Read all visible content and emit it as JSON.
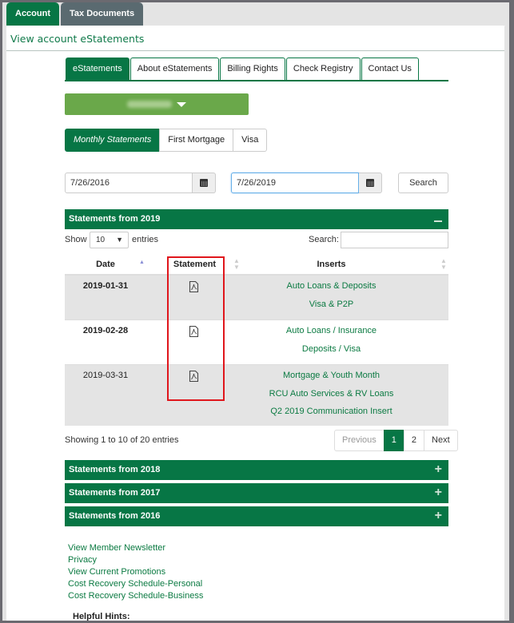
{
  "top_tabs": [
    {
      "label": "Account",
      "active": true
    },
    {
      "label": "Tax Documents",
      "active": false
    }
  ],
  "page_title": "View account eStatements",
  "nav_tabs": [
    {
      "label": "eStatements",
      "active": true
    },
    {
      "label": "About eStatements",
      "active": false
    },
    {
      "label": "Billing Rights",
      "active": false
    },
    {
      "label": "Check Registry",
      "active": false
    },
    {
      "label": "Contact Us",
      "active": false
    }
  ],
  "account_selector": {
    "value": "[redacted account number]",
    "icon": "caret-down-icon"
  },
  "sub_tabs": [
    {
      "label": "Monthly Statements",
      "active": true
    },
    {
      "label": "First Mortgage",
      "active": false
    },
    {
      "label": "Visa",
      "active": false
    }
  ],
  "date_range": {
    "from": "7/26/2016",
    "to": "7/26/2019",
    "calendar_icon": "calendar-icon",
    "search_label": "Search"
  },
  "sections": [
    {
      "title": "Statements from 2019",
      "expanded": true,
      "toggle": "−"
    },
    {
      "title": "Statements from 2018",
      "expanded": false,
      "toggle": "+"
    },
    {
      "title": "Statements from 2017",
      "expanded": false,
      "toggle": "+"
    },
    {
      "title": "Statements from 2016",
      "expanded": false,
      "toggle": "+"
    }
  ],
  "table_controls": {
    "show_label": "Show",
    "page_size": "10",
    "entries_label": "entries",
    "search_label": "Search:",
    "search_value": ""
  },
  "table": {
    "columns": [
      "Date",
      "Statement",
      "Inserts"
    ],
    "sort": {
      "column": "Date",
      "direction": "asc"
    },
    "rows": [
      {
        "date": "2019-01-31",
        "statement_icon": "pdf-icon",
        "inserts": [
          "Auto Loans & Deposits",
          "Visa & P2P"
        ]
      },
      {
        "date": "2019-02-28",
        "statement_icon": "pdf-icon",
        "inserts": [
          "Auto Loans / Insurance",
          "Deposits / Visa"
        ]
      },
      {
        "date": "2019-03-31",
        "statement_icon": "pdf-icon",
        "inserts": [
          "Mortgage & Youth Month",
          "RCU Auto Services & RV Loans",
          "Q2 2019 Communication Insert"
        ]
      }
    ]
  },
  "table_info": "Showing 1 to 10 of 20 entries",
  "pagination": {
    "previous": "Previous",
    "pages": [
      "1",
      "2"
    ],
    "current": "1",
    "next": "Next"
  },
  "footer_links": [
    "View Member Newsletter",
    "Privacy",
    "View Current Promotions",
    "Cost Recovery Schedule-Personal",
    "Cost Recovery Schedule-Business"
  ],
  "helpful_hints_label": "Helpful Hints:",
  "colors": {
    "brand_green": "#077645",
    "account_button_green": "#6aa84a",
    "link_green": "#0b7a42",
    "highlight_red": "#e0161c",
    "inactive_tab": "#5a6a70"
  }
}
